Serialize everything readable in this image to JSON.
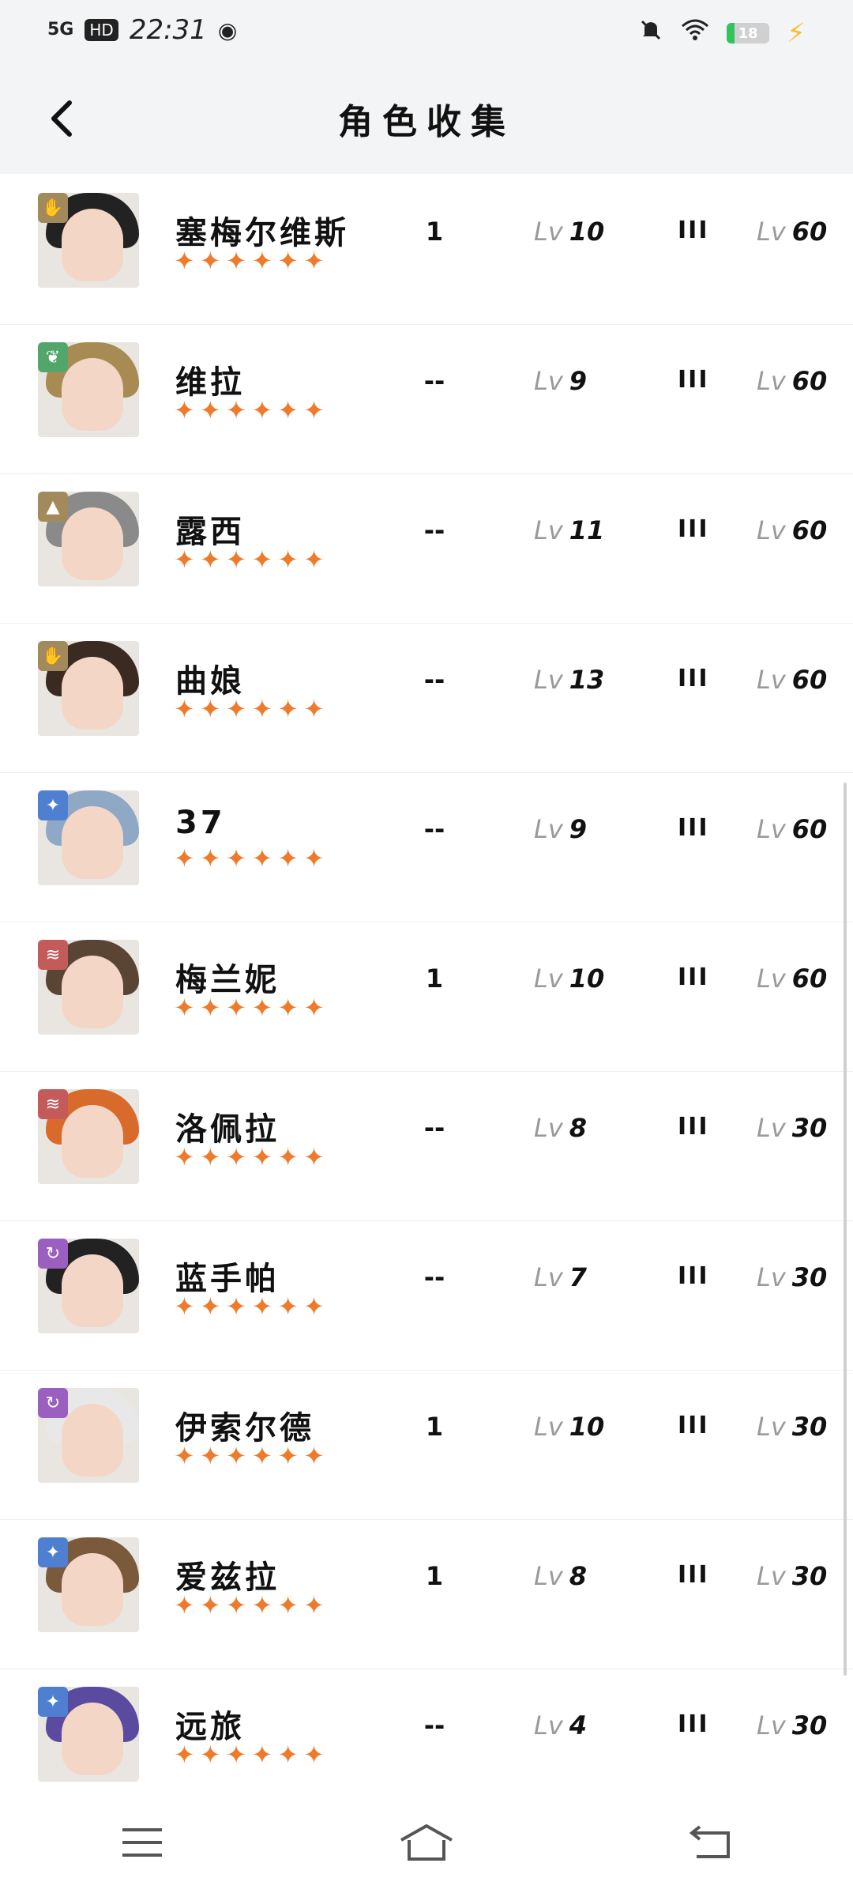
{
  "status": {
    "signal": "5G",
    "hd": "HD",
    "time": "22:31",
    "weibo_icon": "weibo-icon",
    "battery_pct": "18",
    "battery_level": 0.18,
    "battery_color": "#31c45c"
  },
  "header": {
    "title": "角色收集"
  },
  "colors": {
    "star": "#ee7b2c",
    "divider": "#efefef",
    "header_bg": "#f3f4f6"
  },
  "rows": [
    {
      "name": "塞梅尔维斯",
      "stars": 6,
      "col_a": "1",
      "lv_label": "Lv",
      "lv1": "10",
      "rank": "III",
      "lv2": "60",
      "badge_color": "#a38a5c",
      "badge_icon": "hand-icon",
      "hair_color": "#222222"
    },
    {
      "name": "维拉",
      "stars": 6,
      "col_a": "--",
      "lv_label": "Lv",
      "lv1": "9",
      "rank": "III",
      "lv2": "60",
      "badge_color": "#52a66b",
      "badge_icon": "leaf-icon",
      "hair_color": "#a88b53"
    },
    {
      "name": "露西",
      "stars": 6,
      "col_a": "--",
      "lv_label": "Lv",
      "lv1": "11",
      "rank": "III",
      "lv2": "60",
      "badge_color": "#a38a5c",
      "badge_icon": "pyramid-icon",
      "hair_color": "#8a8a8a"
    },
    {
      "name": "曲娘",
      "stars": 6,
      "col_a": "--",
      "lv_label": "Lv",
      "lv1": "13",
      "rank": "III",
      "lv2": "60",
      "badge_color": "#a38a5c",
      "badge_icon": "hand-icon",
      "hair_color": "#3a2a22"
    },
    {
      "name": "37",
      "stars": 6,
      "col_a": "--",
      "lv_label": "Lv",
      "lv1": "9",
      "rank": "III",
      "lv2": "60",
      "badge_color": "#4f7fd1",
      "badge_icon": "sparkle-icon",
      "hair_color": "#8fa8c6"
    },
    {
      "name": "梅兰妮",
      "stars": 6,
      "col_a": "1",
      "lv_label": "Lv",
      "lv1": "10",
      "rank": "III",
      "lv2": "60",
      "badge_color": "#c45b5b",
      "badge_icon": "wave-icon",
      "hair_color": "#5a4535"
    },
    {
      "name": "洛佩拉",
      "stars": 6,
      "col_a": "--",
      "lv_label": "Lv",
      "lv1": "8",
      "rank": "III",
      "lv2": "30",
      "badge_color": "#c45b5b",
      "badge_icon": "wave-icon",
      "hair_color": "#d86a2c"
    },
    {
      "name": "蓝手帕",
      "stars": 6,
      "col_a": "--",
      "lv_label": "Lv",
      "lv1": "7",
      "rank": "III",
      "lv2": "30",
      "badge_color": "#9a5fbf",
      "badge_icon": "cycle-icon",
      "hair_color": "#222222"
    },
    {
      "name": "伊索尔德",
      "stars": 6,
      "col_a": "1",
      "lv_label": "Lv",
      "lv1": "10",
      "rank": "III",
      "lv2": "30",
      "badge_color": "#9a5fbf",
      "badge_icon": "cycle-icon",
      "hair_color": "#e8e8e8"
    },
    {
      "name": "爱兹拉",
      "stars": 6,
      "col_a": "1",
      "lv_label": "Lv",
      "lv1": "8",
      "rank": "III",
      "lv2": "30",
      "badge_color": "#4f7fd1",
      "badge_icon": "sparkle-icon",
      "hair_color": "#7a5a3a"
    },
    {
      "name": "远旅",
      "stars": 6,
      "col_a": "--",
      "lv_label": "Lv",
      "lv1": "4",
      "rank": "III",
      "lv2": "30",
      "badge_color": "#4f7fd1",
      "badge_icon": "sparkle-icon",
      "hair_color": "#5a4aa0"
    }
  ],
  "navbar": {
    "menu_icon": "menu-icon",
    "home_icon": "home-icon",
    "back_icon": "back-arrow-icon"
  }
}
